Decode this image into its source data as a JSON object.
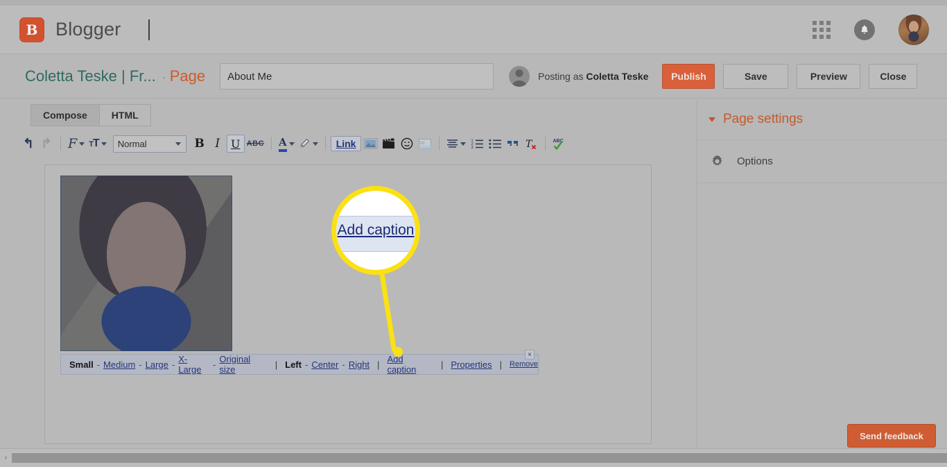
{
  "header": {
    "brand_name": "Blogger",
    "logo_letter": "B",
    "icons": {
      "apps": "apps-grid-icon",
      "bell": "notifications-bell-icon",
      "avatar": "user-avatar"
    }
  },
  "titlerow": {
    "blog_name": "Coletta Teske | Fr...",
    "separator": "·",
    "page_label": "Page",
    "post_title_value": "About Me",
    "post_title_placeholder": "Page title",
    "posting_as_prefix": "Posting as ",
    "posting_as_user": "Coletta Teske",
    "publish_label": "Publish",
    "save_label": "Save",
    "preview_label": "Preview",
    "close_label": "Close"
  },
  "editor": {
    "tabs": [
      {
        "label": "Compose",
        "active": true
      },
      {
        "label": "HTML",
        "active": false
      }
    ],
    "format_select_value": "Normal",
    "toolbar_icons": [
      "undo-icon",
      "redo-icon",
      "font-family-icon",
      "font-size-icon",
      "bold-icon",
      "italic-icon",
      "underline-icon",
      "strikethrough-icon",
      "text-color-icon",
      "highlight-color-icon",
      "link-button",
      "insert-image-icon",
      "insert-video-icon",
      "insert-emoji-icon",
      "jump-break-icon",
      "alignment-icon",
      "numbered-list-icon",
      "bulleted-list-icon",
      "blockquote-icon",
      "remove-formatting-icon",
      "spellcheck-icon"
    ],
    "link_label": "Link",
    "strikethrough_label": "ABC",
    "spellcheck_label": "ABC"
  },
  "image_toolbar": {
    "sizes": [
      {
        "label": "Small",
        "selected": true
      },
      {
        "label": "Medium",
        "selected": false
      },
      {
        "label": "Large",
        "selected": false
      },
      {
        "label": "X-Large",
        "selected": false
      },
      {
        "label": "Original size",
        "selected": false
      }
    ],
    "alignments": [
      {
        "label": "Left",
        "selected": true
      },
      {
        "label": "Center",
        "selected": false
      },
      {
        "label": "Right",
        "selected": false
      }
    ],
    "add_caption_label": "Add caption",
    "properties_label": "Properties",
    "remove_label": "Remove",
    "close_glyph": "×",
    "dash": "-",
    "pipe": "|"
  },
  "callout": {
    "zoom_text": "Add caption",
    "ring_color": "#fbe114"
  },
  "sidebar": {
    "settings_title": "Page settings",
    "items": [
      {
        "label": "Options",
        "icon": "gear-icon"
      }
    ],
    "feedback_label": "Send feedback"
  },
  "scrollbar": {
    "left_arrow": "‹"
  },
  "colors": {
    "brand_orange": "#d2522f",
    "publish_orange": "#d9603a",
    "feedback_orange": "#cf5c33",
    "blog_teal": "#2e6b61",
    "page_orange": "#cc5b2a",
    "link_blue": "#23357a",
    "callout_yellow": "#fbe114"
  }
}
